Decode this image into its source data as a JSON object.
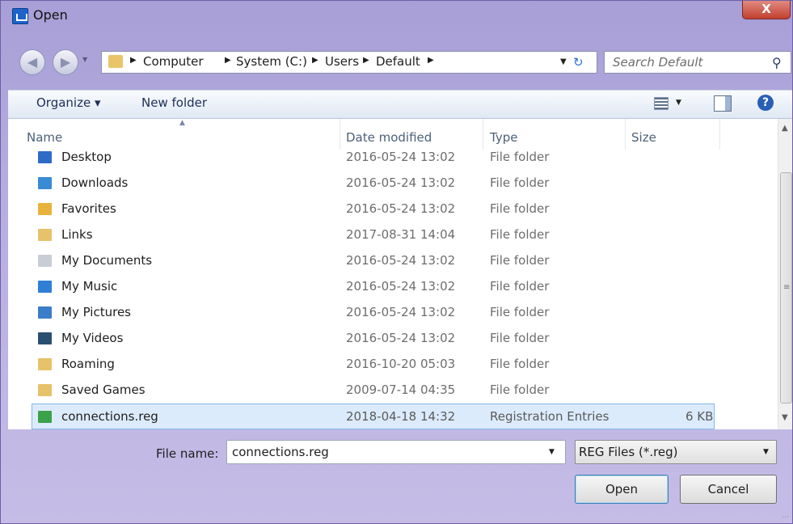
{
  "window": {
    "title": "Open",
    "close_label": "X"
  },
  "nav": {
    "breadcrumbs": [
      "Computer",
      "System (C:)",
      "Users",
      "Default"
    ],
    "search_placeholder": "Search Default"
  },
  "toolbar": {
    "organize": "Organize ▾",
    "new_folder": "New folder",
    "help": "?"
  },
  "columns": {
    "name": "Name",
    "date": "Date modified",
    "type": "Type",
    "size": "Size"
  },
  "files": [
    {
      "name": "Desktop",
      "date": "2016-05-24 13:02",
      "type": "File folder",
      "size": "",
      "icon": "desktop-folder-icon",
      "color": "#2f6ac7"
    },
    {
      "name": "Downloads",
      "date": "2016-05-24 13:02",
      "type": "File folder",
      "size": "",
      "icon": "downloads-folder-icon",
      "color": "#3a8ad4"
    },
    {
      "name": "Favorites",
      "date": "2016-05-24 13:02",
      "type": "File folder",
      "size": "",
      "icon": "favorites-folder-icon",
      "color": "#e8b33c"
    },
    {
      "name": "Links",
      "date": "2017-08-31 14:04",
      "type": "File folder",
      "size": "",
      "icon": "links-folder-icon",
      "color": "#e6c26a"
    },
    {
      "name": "My Documents",
      "date": "2016-05-24 13:02",
      "type": "File folder",
      "size": "",
      "icon": "documents-folder-icon",
      "color": "#c9cdd6"
    },
    {
      "name": "My Music",
      "date": "2016-05-24 13:02",
      "type": "File folder",
      "size": "",
      "icon": "music-folder-icon",
      "color": "#2f7fd6"
    },
    {
      "name": "My Pictures",
      "date": "2016-05-24 13:02",
      "type": "File folder",
      "size": "",
      "icon": "pictures-folder-icon",
      "color": "#3a7dc8"
    },
    {
      "name": "My Videos",
      "date": "2016-05-24 13:02",
      "type": "File folder",
      "size": "",
      "icon": "videos-folder-icon",
      "color": "#2b4f6e"
    },
    {
      "name": "Roaming",
      "date": "2016-10-20 05:03",
      "type": "File folder",
      "size": "",
      "icon": "folder-icon",
      "color": "#e6c26a"
    },
    {
      "name": "Saved Games",
      "date": "2009-07-14 04:35",
      "type": "File folder",
      "size": "",
      "icon": "folder-icon",
      "color": "#e6c26a"
    },
    {
      "name": "connections.reg",
      "date": "2018-04-18 14:32",
      "type": "Registration Entries",
      "size": "6 KB",
      "icon": "registry-file-icon",
      "color": "#3aa34a",
      "selected": true
    }
  ],
  "bottom": {
    "file_name_label": "File name:",
    "file_name_value": "connections.reg",
    "filter_value": "REG Files (*.reg)",
    "open_label": "Open",
    "cancel_label": "Cancel"
  },
  "colors": {
    "selection": "#dcebfc",
    "selection_border": "#85b7ea",
    "frame": "#b7aee0"
  }
}
